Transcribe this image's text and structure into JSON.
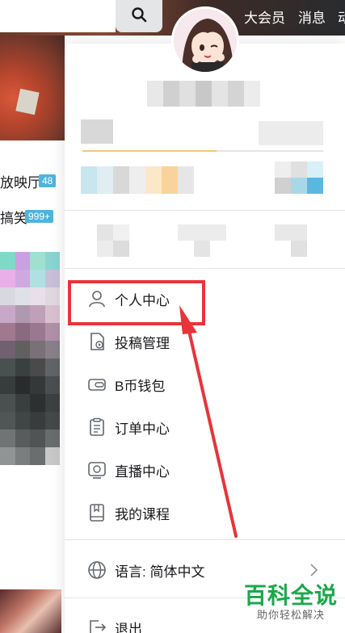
{
  "topbar": {
    "nav_vip": "大会员",
    "nav_messages": "消息",
    "nav_more": "动",
    "search_icon": "search-icon"
  },
  "left_list": {
    "item1_text": "放映厅",
    "item1_badge": "48",
    "item2_text": "搞笑",
    "item2_badge": "999+"
  },
  "menu": {
    "items": [
      {
        "label": "个人中心",
        "icon": "user-icon"
      },
      {
        "label": "投稿管理",
        "icon": "upload-manage-icon"
      },
      {
        "label": "B币钱包",
        "icon": "wallet-icon"
      },
      {
        "label": "订单中心",
        "icon": "order-icon"
      },
      {
        "label": "直播中心",
        "icon": "live-icon"
      },
      {
        "label": "我的课程",
        "icon": "course-icon"
      }
    ],
    "language_label": "语言: 简体中文",
    "logout_label": "退出"
  },
  "annotation": {
    "highlight_color": "#e8343a"
  },
  "watermark": {
    "title": "百科全说",
    "subtitle": "助你轻松解决"
  },
  "colors": {
    "accent_red": "#e8343a",
    "badge_blue": "#4fb4dd",
    "watermark_green": "#1aa84a"
  }
}
